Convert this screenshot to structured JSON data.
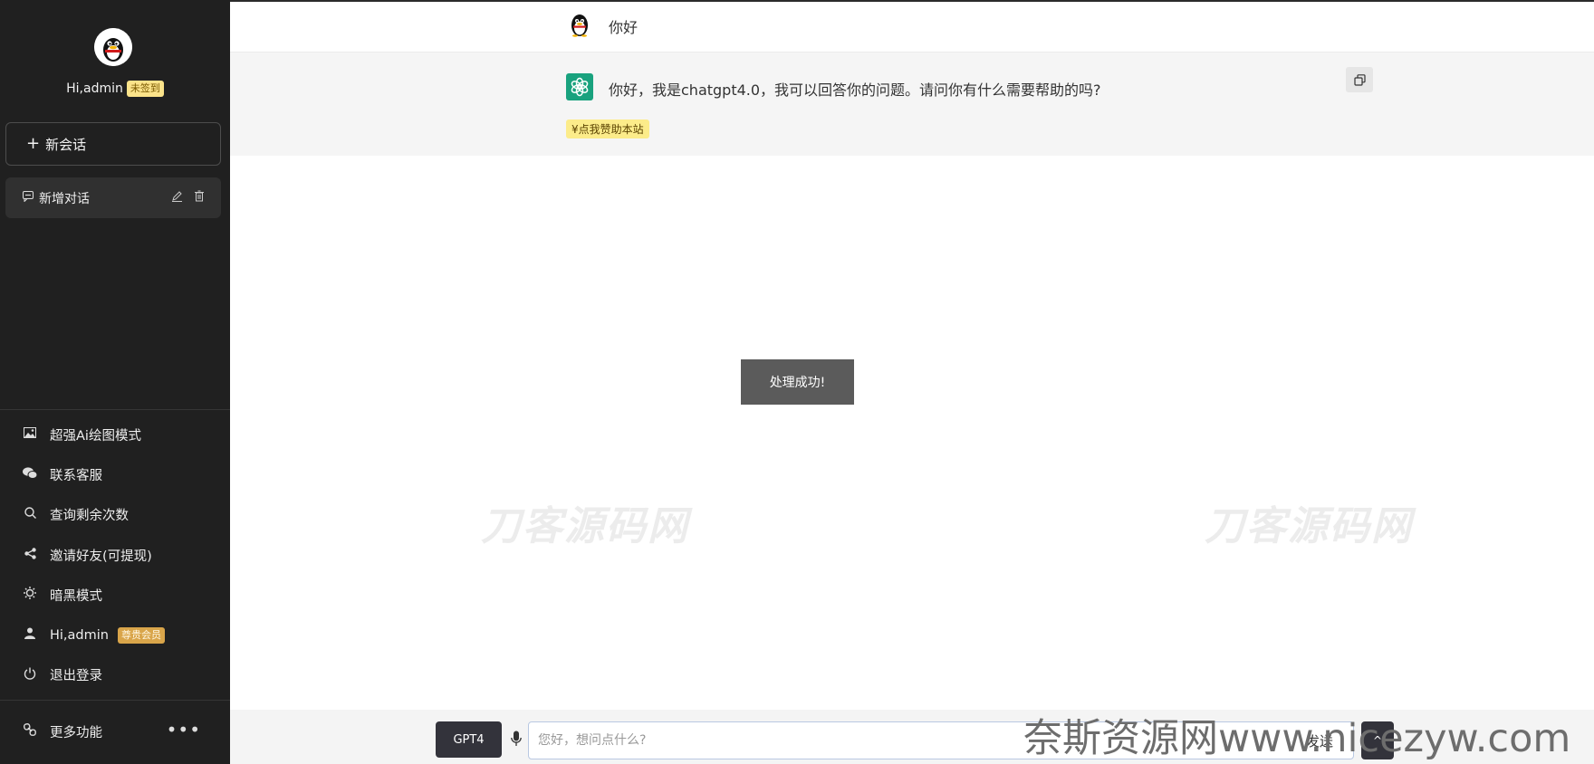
{
  "sidebar": {
    "user_greeting": "Hi,admin",
    "checkin_badge": "未签到",
    "new_chat_label": "新会话",
    "conversation": {
      "title": "新增对话"
    },
    "menu": [
      {
        "label": "超强Ai绘图模式",
        "icon": "image-icon"
      },
      {
        "label": "联系客服",
        "icon": "wechat-icon"
      },
      {
        "label": "查询剩余次数",
        "icon": "search-icon"
      },
      {
        "label": "邀请好友(可提现)",
        "icon": "share-icon"
      },
      {
        "label": "暗黑模式",
        "icon": "sun-icon"
      },
      {
        "label": "Hi,admin",
        "icon": "user-icon",
        "badge": "尊贵会员"
      },
      {
        "label": "退出登录",
        "icon": "power-icon"
      }
    ],
    "more_label": "更多功能"
  },
  "chat": {
    "user_message": "你好",
    "bot_message": "你好，我是chatgpt4.0，我可以回答你的问题。请问你有什么需要帮助的吗?",
    "sponsor_label": "¥点我赞助本站"
  },
  "toast": "处理成功!",
  "watermarks": {
    "left": "刀客源码网",
    "right": "刀客源码网",
    "bottom": "奈斯资源网www.nicezyw.com"
  },
  "input_bar": {
    "model_label": "GPT4",
    "placeholder": "您好，想问点什么?",
    "send_label": "发送",
    "up_label": "^"
  },
  "colors": {
    "sidebar_bg": "#202020",
    "bot_bg": "#f5f5f5",
    "gpt_green": "#19a27e",
    "checkin_badge": "#fbe38a",
    "vip_badge": "#d9a54a"
  }
}
